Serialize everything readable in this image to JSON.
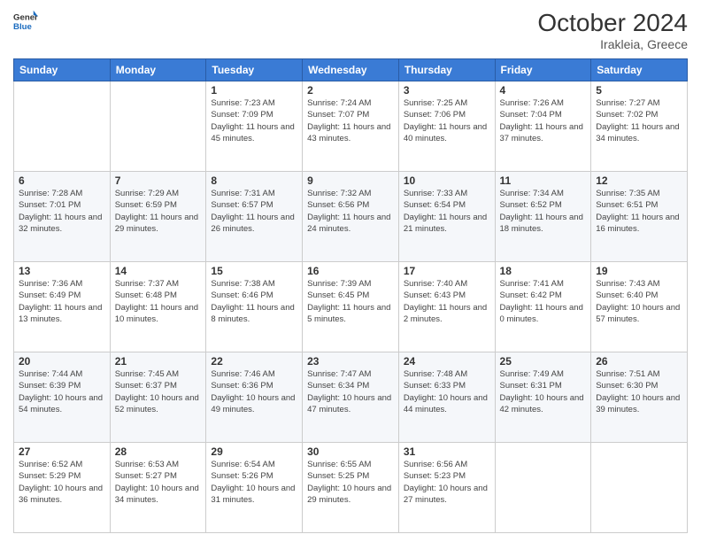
{
  "header": {
    "logo_line1": "General",
    "logo_line2": "Blue",
    "month_title": "October 2024",
    "location": "Irakleia, Greece"
  },
  "days_of_week": [
    "Sunday",
    "Monday",
    "Tuesday",
    "Wednesday",
    "Thursday",
    "Friday",
    "Saturday"
  ],
  "weeks": [
    [
      {
        "day": "",
        "sunrise": "",
        "sunset": "",
        "daylight": ""
      },
      {
        "day": "",
        "sunrise": "",
        "sunset": "",
        "daylight": ""
      },
      {
        "day": "1",
        "sunrise": "Sunrise: 7:23 AM",
        "sunset": "Sunset: 7:09 PM",
        "daylight": "Daylight: 11 hours and 45 minutes."
      },
      {
        "day": "2",
        "sunrise": "Sunrise: 7:24 AM",
        "sunset": "Sunset: 7:07 PM",
        "daylight": "Daylight: 11 hours and 43 minutes."
      },
      {
        "day": "3",
        "sunrise": "Sunrise: 7:25 AM",
        "sunset": "Sunset: 7:06 PM",
        "daylight": "Daylight: 11 hours and 40 minutes."
      },
      {
        "day": "4",
        "sunrise": "Sunrise: 7:26 AM",
        "sunset": "Sunset: 7:04 PM",
        "daylight": "Daylight: 11 hours and 37 minutes."
      },
      {
        "day": "5",
        "sunrise": "Sunrise: 7:27 AM",
        "sunset": "Sunset: 7:02 PM",
        "daylight": "Daylight: 11 hours and 34 minutes."
      }
    ],
    [
      {
        "day": "6",
        "sunrise": "Sunrise: 7:28 AM",
        "sunset": "Sunset: 7:01 PM",
        "daylight": "Daylight: 11 hours and 32 minutes."
      },
      {
        "day": "7",
        "sunrise": "Sunrise: 7:29 AM",
        "sunset": "Sunset: 6:59 PM",
        "daylight": "Daylight: 11 hours and 29 minutes."
      },
      {
        "day": "8",
        "sunrise": "Sunrise: 7:31 AM",
        "sunset": "Sunset: 6:57 PM",
        "daylight": "Daylight: 11 hours and 26 minutes."
      },
      {
        "day": "9",
        "sunrise": "Sunrise: 7:32 AM",
        "sunset": "Sunset: 6:56 PM",
        "daylight": "Daylight: 11 hours and 24 minutes."
      },
      {
        "day": "10",
        "sunrise": "Sunrise: 7:33 AM",
        "sunset": "Sunset: 6:54 PM",
        "daylight": "Daylight: 11 hours and 21 minutes."
      },
      {
        "day": "11",
        "sunrise": "Sunrise: 7:34 AM",
        "sunset": "Sunset: 6:52 PM",
        "daylight": "Daylight: 11 hours and 18 minutes."
      },
      {
        "day": "12",
        "sunrise": "Sunrise: 7:35 AM",
        "sunset": "Sunset: 6:51 PM",
        "daylight": "Daylight: 11 hours and 16 minutes."
      }
    ],
    [
      {
        "day": "13",
        "sunrise": "Sunrise: 7:36 AM",
        "sunset": "Sunset: 6:49 PM",
        "daylight": "Daylight: 11 hours and 13 minutes."
      },
      {
        "day": "14",
        "sunrise": "Sunrise: 7:37 AM",
        "sunset": "Sunset: 6:48 PM",
        "daylight": "Daylight: 11 hours and 10 minutes."
      },
      {
        "day": "15",
        "sunrise": "Sunrise: 7:38 AM",
        "sunset": "Sunset: 6:46 PM",
        "daylight": "Daylight: 11 hours and 8 minutes."
      },
      {
        "day": "16",
        "sunrise": "Sunrise: 7:39 AM",
        "sunset": "Sunset: 6:45 PM",
        "daylight": "Daylight: 11 hours and 5 minutes."
      },
      {
        "day": "17",
        "sunrise": "Sunrise: 7:40 AM",
        "sunset": "Sunset: 6:43 PM",
        "daylight": "Daylight: 11 hours and 2 minutes."
      },
      {
        "day": "18",
        "sunrise": "Sunrise: 7:41 AM",
        "sunset": "Sunset: 6:42 PM",
        "daylight": "Daylight: 11 hours and 0 minutes."
      },
      {
        "day": "19",
        "sunrise": "Sunrise: 7:43 AM",
        "sunset": "Sunset: 6:40 PM",
        "daylight": "Daylight: 10 hours and 57 minutes."
      }
    ],
    [
      {
        "day": "20",
        "sunrise": "Sunrise: 7:44 AM",
        "sunset": "Sunset: 6:39 PM",
        "daylight": "Daylight: 10 hours and 54 minutes."
      },
      {
        "day": "21",
        "sunrise": "Sunrise: 7:45 AM",
        "sunset": "Sunset: 6:37 PM",
        "daylight": "Daylight: 10 hours and 52 minutes."
      },
      {
        "day": "22",
        "sunrise": "Sunrise: 7:46 AM",
        "sunset": "Sunset: 6:36 PM",
        "daylight": "Daylight: 10 hours and 49 minutes."
      },
      {
        "day": "23",
        "sunrise": "Sunrise: 7:47 AM",
        "sunset": "Sunset: 6:34 PM",
        "daylight": "Daylight: 10 hours and 47 minutes."
      },
      {
        "day": "24",
        "sunrise": "Sunrise: 7:48 AM",
        "sunset": "Sunset: 6:33 PM",
        "daylight": "Daylight: 10 hours and 44 minutes."
      },
      {
        "day": "25",
        "sunrise": "Sunrise: 7:49 AM",
        "sunset": "Sunset: 6:31 PM",
        "daylight": "Daylight: 10 hours and 42 minutes."
      },
      {
        "day": "26",
        "sunrise": "Sunrise: 7:51 AM",
        "sunset": "Sunset: 6:30 PM",
        "daylight": "Daylight: 10 hours and 39 minutes."
      }
    ],
    [
      {
        "day": "27",
        "sunrise": "Sunrise: 6:52 AM",
        "sunset": "Sunset: 5:29 PM",
        "daylight": "Daylight: 10 hours and 36 minutes."
      },
      {
        "day": "28",
        "sunrise": "Sunrise: 6:53 AM",
        "sunset": "Sunset: 5:27 PM",
        "daylight": "Daylight: 10 hours and 34 minutes."
      },
      {
        "day": "29",
        "sunrise": "Sunrise: 6:54 AM",
        "sunset": "Sunset: 5:26 PM",
        "daylight": "Daylight: 10 hours and 31 minutes."
      },
      {
        "day": "30",
        "sunrise": "Sunrise: 6:55 AM",
        "sunset": "Sunset: 5:25 PM",
        "daylight": "Daylight: 10 hours and 29 minutes."
      },
      {
        "day": "31",
        "sunrise": "Sunrise: 6:56 AM",
        "sunset": "Sunset: 5:23 PM",
        "daylight": "Daylight: 10 hours and 27 minutes."
      },
      {
        "day": "",
        "sunrise": "",
        "sunset": "",
        "daylight": ""
      },
      {
        "day": "",
        "sunrise": "",
        "sunset": "",
        "daylight": ""
      }
    ]
  ]
}
